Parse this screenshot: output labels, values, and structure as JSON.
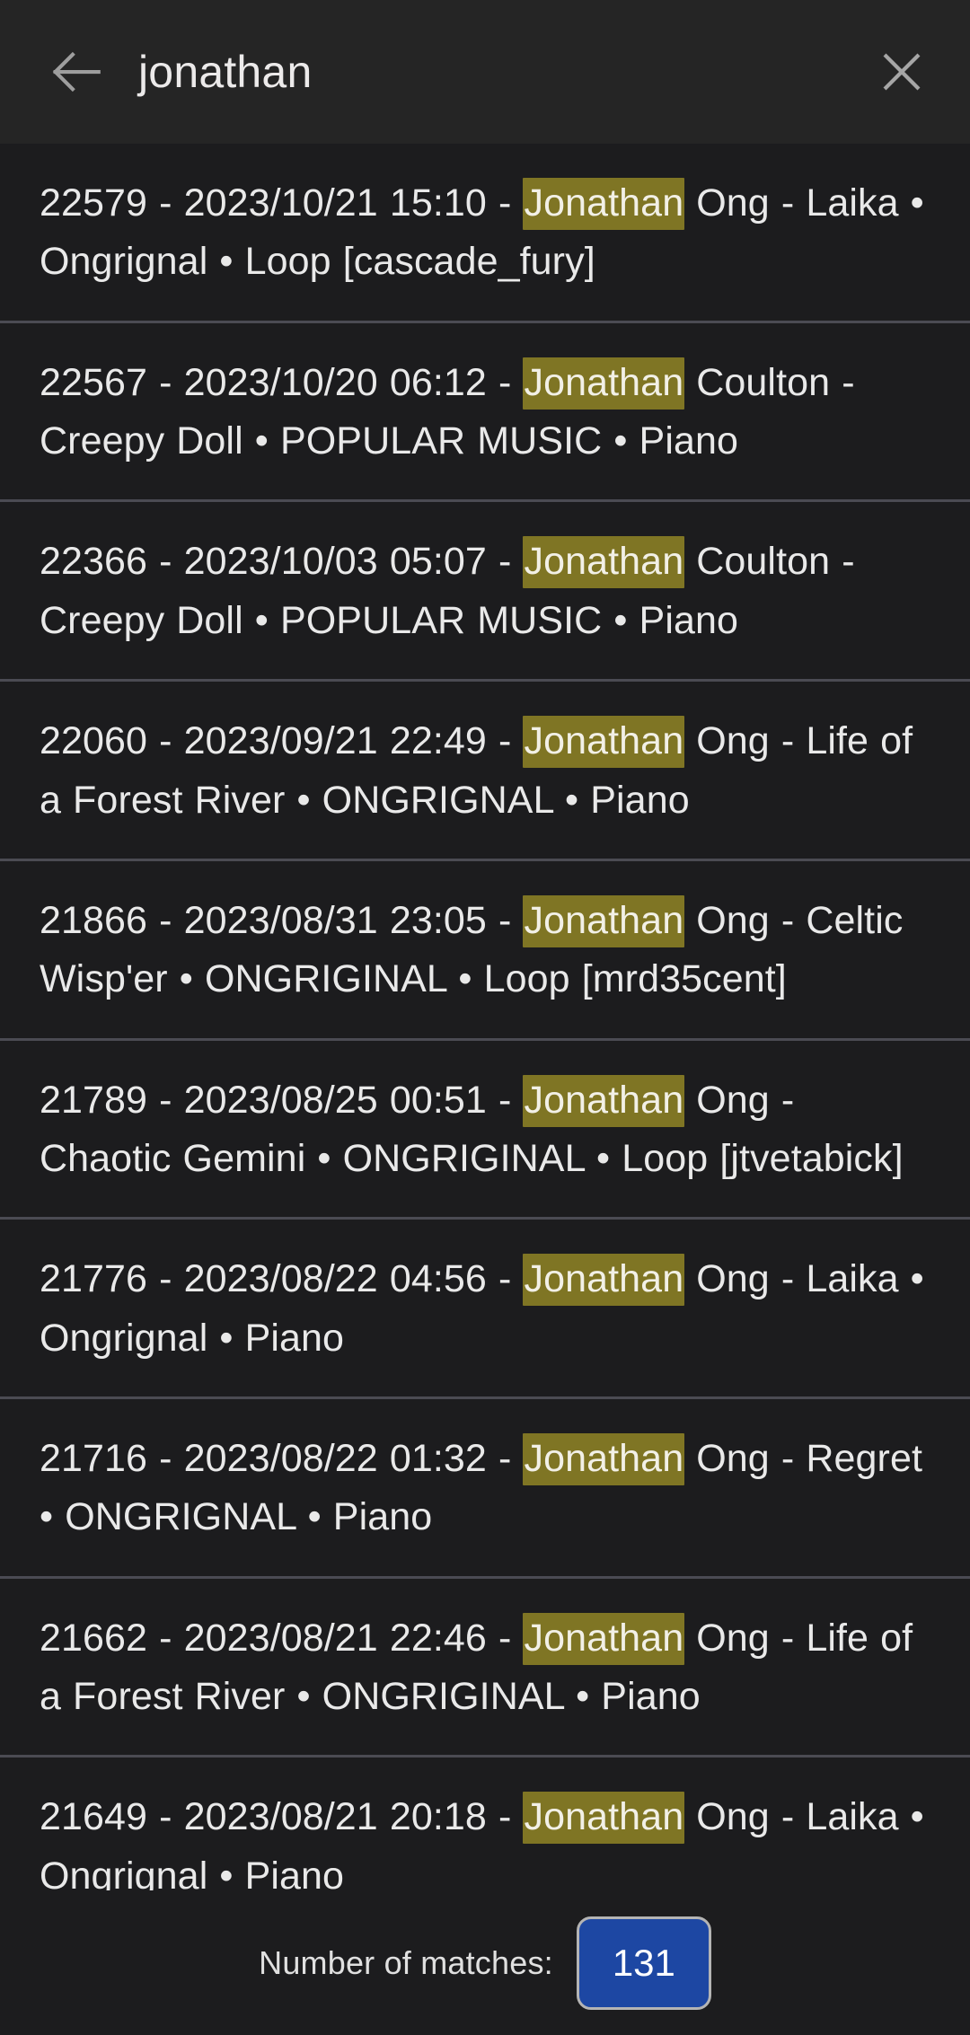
{
  "header": {
    "back_icon": "arrow-left-icon",
    "query": "jonathan",
    "clear_icon": "close-icon"
  },
  "results": [
    {
      "pre": "22579 - 2023/10/21 15:10 - ",
      "match": "Jonathan",
      "post": " Ong - Laika • Ongrignal • Loop [cascade_fury]"
    },
    {
      "pre": "22567 - 2023/10/20 06:12 - ",
      "match": "Jonathan",
      "post": " Coulton - Creepy Doll • POPULAR MUSIC • Piano"
    },
    {
      "pre": "22366 - 2023/10/03 05:07 - ",
      "match": "Jonathan",
      "post": " Coulton - Creepy Doll • POPULAR MUSIC • Piano"
    },
    {
      "pre": "22060 - 2023/09/21 22:49 - ",
      "match": "Jonathan",
      "post": " Ong - Life of a Forest River • ONGRIGNAL • Piano"
    },
    {
      "pre": "21866 - 2023/08/31 23:05 - ",
      "match": "Jonathan",
      "post": " Ong - Celtic Wisp'er • ONGRIGINAL • Loop [mrd35cent]"
    },
    {
      "pre": "21789 - 2023/08/25 00:51 - ",
      "match": "Jonathan",
      "post": " Ong - Chaotic Gemini • ONGRIGINAL • Loop [jtvetabick]"
    },
    {
      "pre": "21776 - 2023/08/22 04:56 - ",
      "match": "Jonathan",
      "post": " Ong - Laika • Ongrignal • Piano"
    },
    {
      "pre": "21716 - 2023/08/22 01:32 - ",
      "match": "Jonathan",
      "post": " Ong - Regret • ONGRIGNAL • Piano"
    },
    {
      "pre": "21662 - 2023/08/21 22:46 - ",
      "match": "Jonathan",
      "post": " Ong - Life of a Forest River • ONGRIGINAL • Piano"
    },
    {
      "pre": "21649 - 2023/08/21 20:18 - ",
      "match": "Jonathan",
      "post": " Ong - Laika • Ongrignal • Piano"
    }
  ],
  "footer": {
    "matches_label": "Number of matches:",
    "matches_count": "131"
  },
  "colors": {
    "header_background": "#252525",
    "list_background": "#1c1c1e",
    "divider": "#4b4b53",
    "highlight": "#7f7524",
    "button_blue": "#1d47a3",
    "button_border": "#b4b4b4",
    "text": "#e9e9e9",
    "icon": "#9e9e9e"
  }
}
